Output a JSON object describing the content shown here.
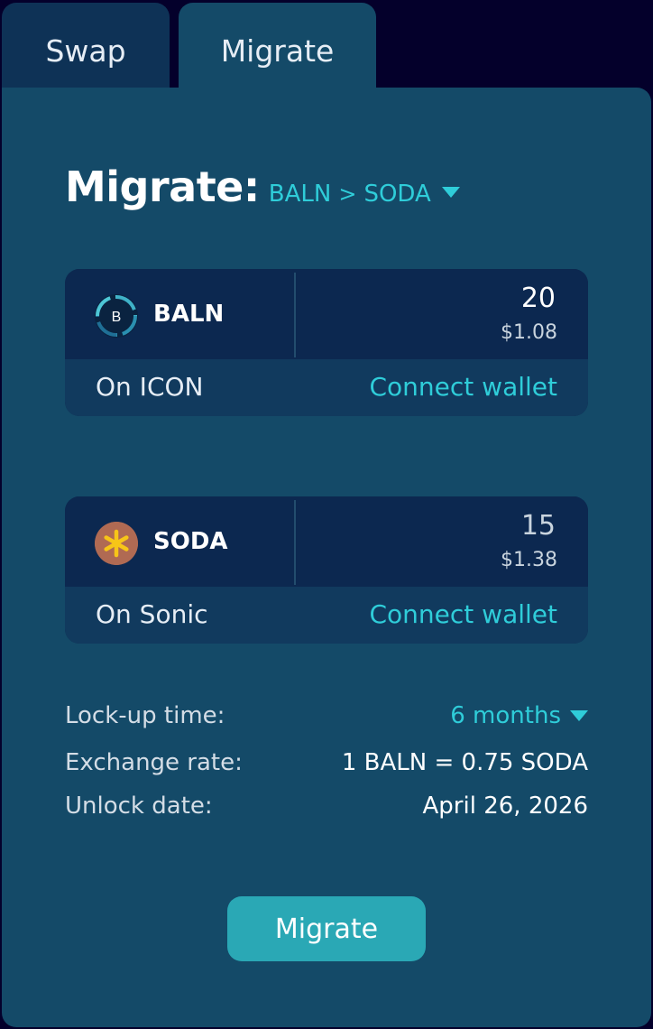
{
  "tabs": [
    {
      "label": "Swap",
      "active": false
    },
    {
      "label": "Migrate",
      "active": true
    }
  ],
  "heading": {
    "title": "Migrate:",
    "from_token": "BALN",
    "separator": ">",
    "to_token": "SODA"
  },
  "from_card": {
    "token": "BALN",
    "icon_letter": "B",
    "amount": "20",
    "usd_value": "$1.08",
    "network": "On ICON",
    "connect_label": "Connect wallet"
  },
  "to_card": {
    "token": "SODA",
    "amount": "15",
    "usd_value": "$1.38",
    "network": "On Sonic",
    "connect_label": "Connect wallet"
  },
  "details": {
    "lockup_label": "Lock-up time:",
    "lockup_value": "6 months",
    "rate_label": "Exchange rate:",
    "rate_value": "1 BALN = 0.75 SODA",
    "unlock_label": "Unlock date:",
    "unlock_value": "April 26, 2026"
  },
  "migrate_button": "Migrate",
  "colors": {
    "accent": "#2fcdd9",
    "button": "#2aa8b5",
    "panel": "#144a68",
    "background": "#04002b"
  }
}
